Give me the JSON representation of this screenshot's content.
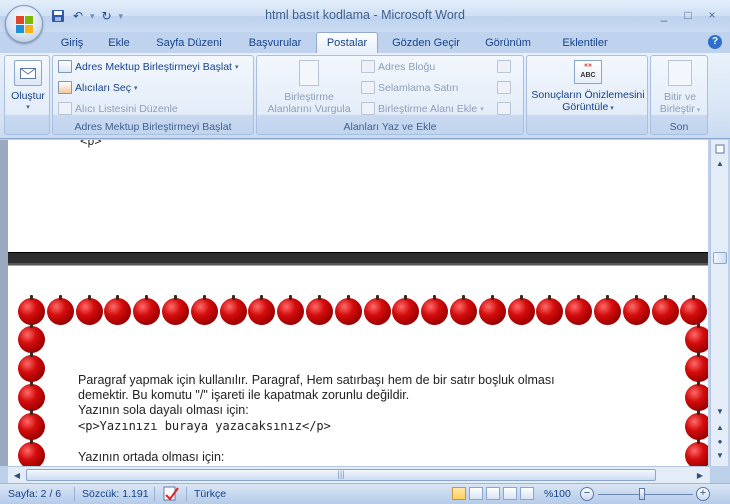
{
  "window": {
    "title": "html basıt kodlama - Microsoft Word",
    "controls": [
      "_",
      "□",
      "×"
    ]
  },
  "quick_access": {
    "undo_symbol": "↶",
    "redo_symbol": "↻",
    "more_symbol": "▾"
  },
  "tabs": [
    {
      "label": "Giriş"
    },
    {
      "label": "Ekle"
    },
    {
      "label": "Sayfa Düzeni"
    },
    {
      "label": "Başvurular"
    },
    {
      "label": "Postalar"
    },
    {
      "label": "Gözden Geçir"
    },
    {
      "label": "Görünüm"
    },
    {
      "label": "Eklentiler"
    }
  ],
  "active_tab": "Postalar",
  "help": "?",
  "ribbon": {
    "create": {
      "label": "Oluştur"
    },
    "mail_merge_start": {
      "group_label": "Adres Mektup Birleştirmeyi Başlat",
      "start_label": "Adres Mektup Birleştirmeyi Başlat",
      "select_recipients_label": "Alıcıları Seç",
      "edit_list_label": "Alıcı Listesini Düzenle"
    },
    "write_insert": {
      "group_label": "Alanları Yaz ve Ekle",
      "highlight_label_1": "Birleştirme",
      "highlight_label_2": "Alanlarını Vurgula",
      "address_block_label": "Adres Bloğu",
      "greeting_line_label": "Selamlama Satırı",
      "insert_field_label": "Birleştirme Alanı Ekle"
    },
    "preview": {
      "icon_text_top": "«»",
      "icon_text_bottom": "ABC",
      "label_1": "Sonuçların Önizlemesini",
      "label_2": "Görüntüle"
    },
    "finish": {
      "group_label": "Son",
      "label_1": "Bitir ve",
      "label_2": "Birleştir"
    }
  },
  "document": {
    "top_fragment": "<p>",
    "line1": "Paragraf yapmak için kullanılır.  Paragraf, Hem satırbaşı hem de bir satır boşluk olması",
    "line2": "demektir. Bu komutu \"/\" işareti ile kapatmak zorunlu değildir.",
    "line3": "Yazının sola dayalı olması için:",
    "line4": "<p>Yazınızı buraya yazacaksınız</p>",
    "line5": "Yazının ortada olması için:"
  },
  "status": {
    "page": "Sayfa: 2 / 6",
    "words": "Sözcük: 1.191",
    "language": "Türkçe",
    "zoom": "%100",
    "zoom_level_percent": 100
  },
  "colors": {
    "apple_red": "#cc0000",
    "ribbon_text": "#15428b"
  }
}
